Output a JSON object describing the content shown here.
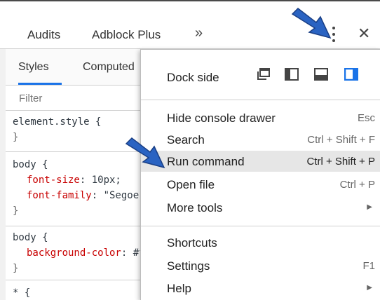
{
  "tabs": {
    "audits": "Audits",
    "adblock": "Adblock Plus",
    "more": "»",
    "close": "✕"
  },
  "styles_pane": {
    "tab_styles": "Styles",
    "tab_computed": "Computed",
    "filter_placeholder": "Filter",
    "rules": [
      {
        "line1": "element.style {",
        "line2": "}"
      },
      {
        "selector": "body {",
        "p1_name": "font-size",
        "p1_val": ": 10px;",
        "p2_name": "font-family",
        "p2_val": ": \"Segoe UI\";",
        "close": "}"
      },
      {
        "selector": "body {",
        "p1_name": "background-color",
        "p1_val": ": #fff;",
        "close": "}"
      },
      {
        "selector": "* {"
      }
    ]
  },
  "menu": {
    "dock_side_label": "Dock side",
    "items": [
      {
        "label": "Hide console drawer",
        "shortcut": "Esc"
      },
      {
        "label": "Search",
        "shortcut": "Ctrl + Shift + F"
      },
      {
        "label": "Run command",
        "shortcut": "Ctrl + Shift + P"
      },
      {
        "label": "Open file",
        "shortcut": "Ctrl + P"
      },
      {
        "label": "More tools",
        "shortcut": "▶"
      },
      {
        "label": "Shortcuts",
        "shortcut": ""
      },
      {
        "label": "Settings",
        "shortcut": "F1"
      },
      {
        "label": "Help",
        "shortcut": "▶"
      }
    ]
  },
  "colors": {
    "accent": "#1a73e8",
    "annotation_arrow": "#2a63c2"
  }
}
